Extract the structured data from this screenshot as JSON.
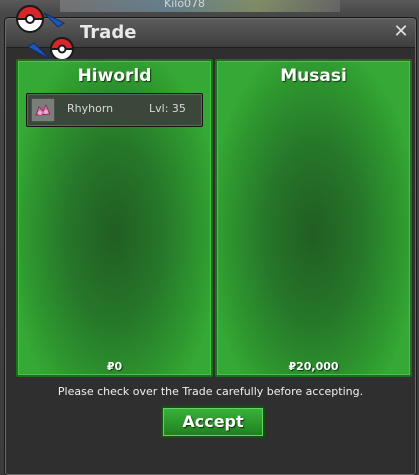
{
  "window": {
    "title": "Trade",
    "close_label": "✕"
  },
  "background": {
    "top_text": "Kilo078"
  },
  "trade": {
    "left": {
      "player": "Hiworld",
      "items": [
        {
          "name": "Rhyhorn",
          "level": "Lvl: 35",
          "icon": "pokemon-icon"
        }
      ],
      "currency_symbol": "₽",
      "money": "0"
    },
    "right": {
      "player": "Musasi",
      "items": [],
      "currency_symbol": "₽",
      "money": "20,000"
    }
  },
  "notice": "Please check over the Trade carefully before accepting.",
  "accept_label": "Accept",
  "colors": {
    "panel_green": "#2f9a2f",
    "accept_green": "#2a9a2a",
    "window_dark": "#2f2f2f"
  }
}
